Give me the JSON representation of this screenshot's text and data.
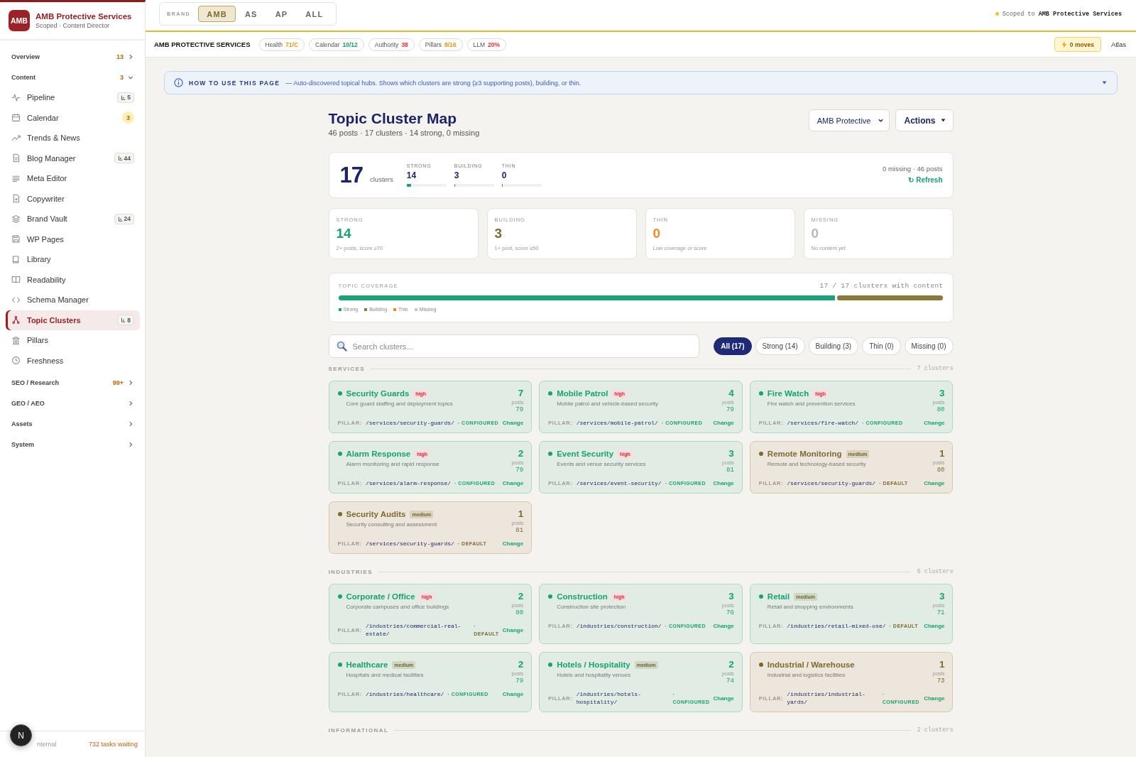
{
  "sidebar": {
    "brand": {
      "logo": "AMB",
      "name": "AMB Protective Services",
      "subtitle": "Scoped · Content Director"
    },
    "sections": [
      {
        "label": "Overview",
        "count": "13",
        "expanded": false
      },
      {
        "label": "Content",
        "count": "3",
        "expanded": true,
        "items": [
          {
            "label": "Pipeline",
            "selected": false,
            "badge": {
              "kind": "shortcut",
              "text": "5"
            }
          },
          {
            "label": "Calendar",
            "selected": false,
            "badge": {
              "kind": "alert",
              "text": "3"
            }
          },
          {
            "label": "Trends & News",
            "selected": false
          },
          {
            "label": "Blog Manager",
            "selected": false,
            "badge": {
              "kind": "shortcut",
              "text": "44"
            }
          },
          {
            "label": "Meta Editor",
            "selected": false
          },
          {
            "label": "Copywriter",
            "selected": false
          },
          {
            "label": "Brand Vault",
            "selected": false,
            "badge": {
              "kind": "shortcut",
              "text": "24"
            }
          },
          {
            "label": "WP Pages",
            "selected": false
          },
          {
            "label": "Library",
            "selected": false
          },
          {
            "label": "Readability",
            "selected": false
          },
          {
            "label": "Schema Manager",
            "selected": false
          },
          {
            "label": "Topic Clusters",
            "selected": true,
            "badge": {
              "kind": "shortcut",
              "text": "8"
            }
          },
          {
            "label": "Pillars",
            "selected": false
          },
          {
            "label": "Freshness",
            "selected": false
          }
        ]
      },
      {
        "label": "SEO / Research",
        "count": "99+",
        "expanded": false
      },
      {
        "label": "GEO / AEO",
        "expanded": false
      },
      {
        "label": "Assets",
        "expanded": false
      },
      {
        "label": "System",
        "expanded": false
      }
    ],
    "footer": {
      "launcher": "N",
      "workspace": "nternal",
      "tasks": "732 tasks waiting"
    }
  },
  "topbar": {
    "brand_label": "BRAND",
    "brands": [
      {
        "label": "AMB",
        "selected": true
      },
      {
        "label": "AS",
        "selected": false
      },
      {
        "label": "AP",
        "selected": false
      },
      {
        "label": "ALL",
        "selected": false
      }
    ],
    "scope": "Scoped to **AMB Protective Services**"
  },
  "context_bar": {
    "title": "AMB PROTECTIVE SERVICES",
    "metrics": [
      {
        "label": "Health",
        "value": "71/C",
        "color": "#e8950f"
      },
      {
        "label": "Calendar",
        "value": "10/12",
        "color": "#14a06b"
      },
      {
        "label": "Authority",
        "value": "38",
        "color": "#e5323b"
      },
      {
        "label": "Pillars",
        "value": "8/16",
        "color": "#e8950f"
      },
      {
        "label": "LLM",
        "value": "20%",
        "color": "#e5323b"
      }
    ],
    "moves": "0 moves",
    "atlas": "Atlas"
  },
  "banner": {
    "title": "HOW TO USE THIS PAGE",
    "text": "— Auto-discovered topical hubs. Shows which clusters are strong (≥3 supporting posts), building, or thin.",
    "expanded": false
  },
  "header": {
    "title": "Topic Cluster Map",
    "subtitle": "46 posts · 17 clusters · 14 strong, 0 missing",
    "brand_select": "AMB Protective",
    "actions": "Actions"
  },
  "summary": {
    "total": "17",
    "total_label": "clusters",
    "stats": [
      {
        "label": "STRONG",
        "value": "14",
        "level": 0.12
      },
      {
        "label": "BUILDING",
        "value": "3",
        "level": 0.03
      },
      {
        "label": "THIN",
        "value": "0",
        "level": 0
      }
    ],
    "meta": "0 missing · 46 posts",
    "refresh": "↻ Refresh"
  },
  "stat_cards": [
    {
      "kind": "strong",
      "label": "STRONG",
      "value": "14",
      "note": "2+ posts, score ≥70"
    },
    {
      "kind": "building",
      "label": "BUILDING",
      "value": "3",
      "note": "1+ post, score ≥50"
    },
    {
      "kind": "thin",
      "label": "THIN",
      "value": "0",
      "note": "Low coverage or score"
    },
    {
      "kind": "missing",
      "label": "MISSING",
      "value": "0",
      "note": "No content yet"
    }
  ],
  "coverage": {
    "title": "TOPIC COVERAGE",
    "summary": "17 / 17 clusters with content",
    "segments": [
      {
        "color": "#1aa37a",
        "level": 0.824
      },
      {
        "color": "#8a7a3a",
        "level": 0.176
      }
    ],
    "legend": [
      {
        "label": "Strong",
        "color": "#1aa37a"
      },
      {
        "label": "Building",
        "color": "#8a7a3a"
      },
      {
        "label": "Thin",
        "color": "#f08a24"
      },
      {
        "label": "Missing",
        "color": "#c6c6c6"
      }
    ]
  },
  "filters": {
    "search": {
      "placeholder": "Search clusters..."
    },
    "chips": [
      {
        "label": "All (17)",
        "selected": true
      },
      {
        "label": "Strong (14)",
        "selected": false
      },
      {
        "label": "Building (3)",
        "selected": false
      },
      {
        "label": "Thin (0)",
        "selected": false
      },
      {
        "label": "Missing (0)",
        "selected": false
      }
    ]
  },
  "groups": [
    {
      "title": "SERVICES",
      "count": "7 clusters",
      "clusters": [
        {
          "name": "Security Guards",
          "kind": "strong",
          "priority": {
            "label": "high",
            "kind": "high"
          },
          "description": "Core guard staffing and deployment topics",
          "posts": "7",
          "posts_label": "posts",
          "score": "79",
          "pillar": {
            "label": "PILLAR:",
            "path": "/services/security-guards/",
            "state": {
              "label": "· CONFIGURED",
              "kind": "configured"
            },
            "action": "Change"
          }
        },
        {
          "name": "Mobile Patrol",
          "kind": "strong",
          "priority": {
            "label": "high",
            "kind": "high"
          },
          "description": "Mobile patrol and vehicle-based security",
          "posts": "4",
          "posts_label": "posts",
          "score": "79",
          "pillar": {
            "label": "PILLAR:",
            "path": "/services/mobile-patrol/",
            "state": {
              "label": "· CONFIGURED",
              "kind": "configured"
            },
            "action": "Change"
          }
        },
        {
          "name": "Fire Watch",
          "kind": "strong",
          "priority": {
            "label": "high",
            "kind": "high"
          },
          "description": "Fire watch and prevention services",
          "posts": "3",
          "posts_label": "posts",
          "score": "80",
          "pillar": {
            "label": "PILLAR:",
            "path": "/services/fire-watch/",
            "state": {
              "label": "· CONFIGURED",
              "kind": "configured"
            },
            "action": "Change"
          }
        },
        {
          "name": "Alarm Response",
          "kind": "strong",
          "priority": {
            "label": "high",
            "kind": "high"
          },
          "description": "Alarm monitoring and rapid response",
          "posts": "2",
          "posts_label": "posts",
          "score": "79",
          "pillar": {
            "label": "PILLAR:",
            "path": "/services/alarm-response/",
            "state": {
              "label": "· CONFIGURED",
              "kind": "configured"
            },
            "action": "Change"
          }
        },
        {
          "name": "Event Security",
          "kind": "strong",
          "priority": {
            "label": "high",
            "kind": "high"
          },
          "description": "Events and venue security services",
          "posts": "3",
          "posts_label": "posts",
          "score": "81",
          "pillar": {
            "label": "PILLAR:",
            "path": "/services/event-security/",
            "state": {
              "label": "· CONFIGURED",
              "kind": "configured"
            },
            "action": "Change"
          }
        },
        {
          "name": "Remote Monitoring",
          "kind": "building",
          "priority": {
            "label": "medium",
            "kind": "medium"
          },
          "description": "Remote and technology-based security",
          "posts": "1",
          "posts_label": "posts",
          "score": "80",
          "pillar": {
            "label": "PILLAR:",
            "path": "/services/security-guards/",
            "state": {
              "label": "· DEFAULT",
              "kind": "default"
            },
            "action": "Change"
          }
        },
        {
          "name": "Security Audits",
          "kind": "building",
          "priority": {
            "label": "medium",
            "kind": "medium"
          },
          "description": "Security consulting and assessment",
          "posts": "1",
          "posts_label": "posts",
          "score": "81",
          "pillar": {
            "label": "PILLAR:",
            "path": "/services/security-guards/",
            "state": {
              "label": "· DEFAULT",
              "kind": "default"
            },
            "action": "Change"
          }
        }
      ]
    },
    {
      "title": "INDUSTRIES",
      "count": "6 clusters",
      "clusters": [
        {
          "name": "Corporate / Office",
          "kind": "strong",
          "priority": {
            "label": "high",
            "kind": "high"
          },
          "description": "Corporate campuses and office buildings",
          "posts": "2",
          "posts_label": "posts",
          "score": "80",
          "pillar": {
            "label": "PILLAR:",
            "path": "/industries/commercial-real-estate/",
            "state": {
              "label": "· DEFAULT",
              "kind": "default"
            },
            "action": "Change"
          }
        },
        {
          "name": "Construction",
          "kind": "strong",
          "priority": {
            "label": "high",
            "kind": "high"
          },
          "description": "Construction site protection",
          "posts": "3",
          "posts_label": "posts",
          "score": "76",
          "pillar": {
            "label": "PILLAR:",
            "path": "/industries/construction/",
            "state": {
              "label": "· CONFIGURED",
              "kind": "configured"
            },
            "action": "Change"
          }
        },
        {
          "name": "Retail",
          "kind": "strong",
          "priority": {
            "label": "medium",
            "kind": "medium"
          },
          "description": "Retail and shopping environments",
          "posts": "3",
          "posts_label": "posts",
          "score": "71",
          "pillar": {
            "label": "PILLAR:",
            "path": "/industries/retail-mixed-use/",
            "state": {
              "label": "· DEFAULT",
              "kind": "default"
            },
            "action": "Change"
          }
        },
        {
          "name": "Healthcare",
          "kind": "strong",
          "priority": {
            "label": "medium",
            "kind": "medium"
          },
          "description": "Hospitals and medical facilities",
          "posts": "2",
          "posts_label": "posts",
          "score": "79",
          "pillar": {
            "label": "PILLAR:",
            "path": "/industries/healthcare/",
            "state": {
              "label": "· CONFIGURED",
              "kind": "configured"
            },
            "action": "Change"
          }
        },
        {
          "name": "Hotels / Hospitality",
          "kind": "strong",
          "priority": {
            "label": "medium",
            "kind": "medium"
          },
          "description": "Hotels and hospitality venues",
          "posts": "2",
          "posts_label": "posts",
          "score": "74",
          "pillar": {
            "label": "PILLAR:",
            "path": "/industries/hotels-hospitality/",
            "state": {
              "label": "· CONFIGURED",
              "kind": "configured"
            },
            "action": "Change"
          }
        },
        {
          "name": "Industrial / Warehouse",
          "kind": "building",
          "description": "Industrial and logistics facilities",
          "posts": "1",
          "posts_label": "posts",
          "score": "73",
          "pillar": {
            "label": "PILLAR:",
            "path": "/industries/industrial-yards/",
            "state": {
              "label": "· CONFIGURED",
              "kind": "configured"
            },
            "action": "Change"
          }
        }
      ]
    },
    {
      "title": "INFORMATIONAL",
      "count": "2 clusters"
    }
  ]
}
